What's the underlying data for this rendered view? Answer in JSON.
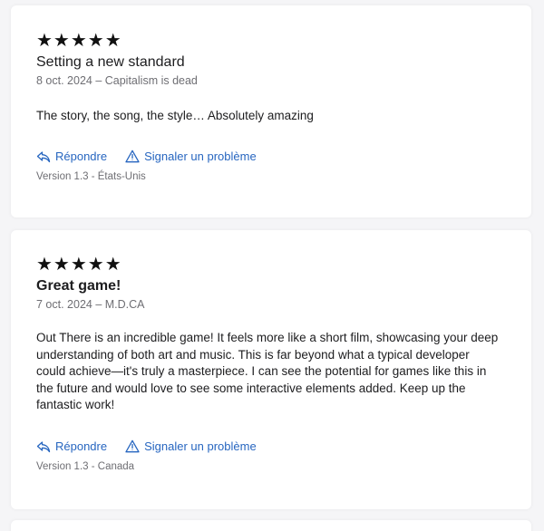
{
  "colors": {
    "link": "#2766c0",
    "text": "#1d1d1f",
    "muted": "#6e6e73",
    "star": "#111111"
  },
  "reviews": [
    {
      "rating": 5,
      "stars": "★★★★★",
      "title": "Setting a new standard",
      "meta": "8 oct. 2024 – Capitalism is dead",
      "body": "The story, the song, the style… Absolutely amazing",
      "reply_label": "Répondre",
      "reply_icon": "reply-icon",
      "report_label": "Signaler un problème",
      "report_icon": "warning-icon",
      "version": "Version 1.3 - États-Unis"
    },
    {
      "rating": 5,
      "stars": "★★★★★",
      "title": "Great game!",
      "meta": "7 oct. 2024 – M.D.CA",
      "body": "Out There is an incredible game! It feels more like a short film, showcasing your deep understanding of both art and music. This is far beyond what a typical developer could achieve—it's truly a masterpiece. I can see the potential for games like this in the future and would love to see some interactive elements added. Keep up the fantastic work!",
      "reply_label": "Répondre",
      "reply_icon": "reply-icon",
      "report_label": "Signaler un problème",
      "report_icon": "warning-icon",
      "version": "Version 1.3 - Canada"
    }
  ]
}
